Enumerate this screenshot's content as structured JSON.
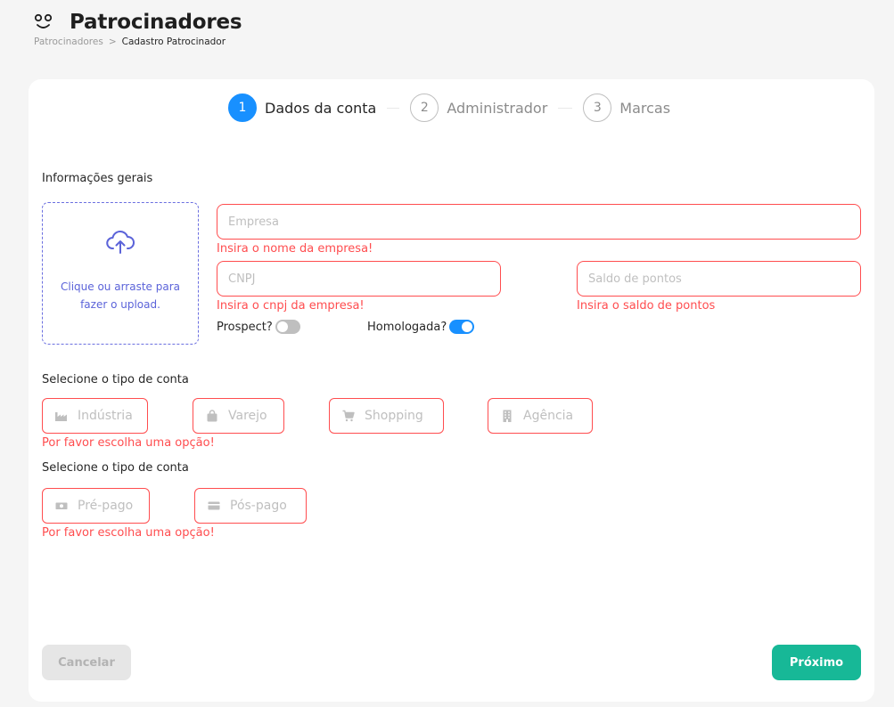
{
  "header": {
    "title": "Patrocinadores",
    "breadcrumb": {
      "parent": "Patrocinadores",
      "separator": ">",
      "current": "Cadastro Patrocinador"
    }
  },
  "steps": [
    {
      "number": "1",
      "label": "Dados da conta",
      "active": true
    },
    {
      "number": "2",
      "label": "Administrador",
      "active": false
    },
    {
      "number": "3",
      "label": "Marcas",
      "active": false
    }
  ],
  "general": {
    "section_label": "Informações gerais",
    "upload_text_line1": "Clique ou arraste para",
    "upload_text_line2": "fazer o upload.",
    "company": {
      "placeholder": "Empresa",
      "value": "",
      "error": "Insira o nome da empresa!"
    },
    "cnpj": {
      "placeholder": "CNPJ",
      "value": "",
      "error": "Insira o cnpj da empresa!"
    },
    "points": {
      "placeholder": "Saldo de pontos",
      "value": "",
      "error": "Insira o saldo de pontos"
    },
    "prospect": {
      "label": "Prospect?",
      "checked": false
    },
    "homologada": {
      "label": "Homologada?",
      "checked": true
    }
  },
  "account_type": {
    "section_label": "Selecione o tipo de conta",
    "options": [
      {
        "label": "Indústria",
        "icon": "factory-icon"
      },
      {
        "label": "Varejo",
        "icon": "shopping-bag-icon"
      },
      {
        "label": "Shopping",
        "icon": "shopping-cart-icon"
      },
      {
        "label": "Agência",
        "icon": "building-icon"
      }
    ],
    "error": "Por favor escolha uma opção!"
  },
  "payment_type": {
    "section_label": "Selecione o tipo de conta",
    "options": [
      {
        "label": "Pré-pago",
        "icon": "money-icon"
      },
      {
        "label": "Pós-pago",
        "icon": "credit-card-icon"
      }
    ],
    "error": "Por favor escolha uma opção!"
  },
  "actions": {
    "cancel_label": "Cancelar",
    "next_label": "Próximo"
  },
  "colors": {
    "primary": "#1890ff",
    "error": "#ff4d4f",
    "success_button": "#17b897",
    "upload_accent": "#5b63d9"
  }
}
